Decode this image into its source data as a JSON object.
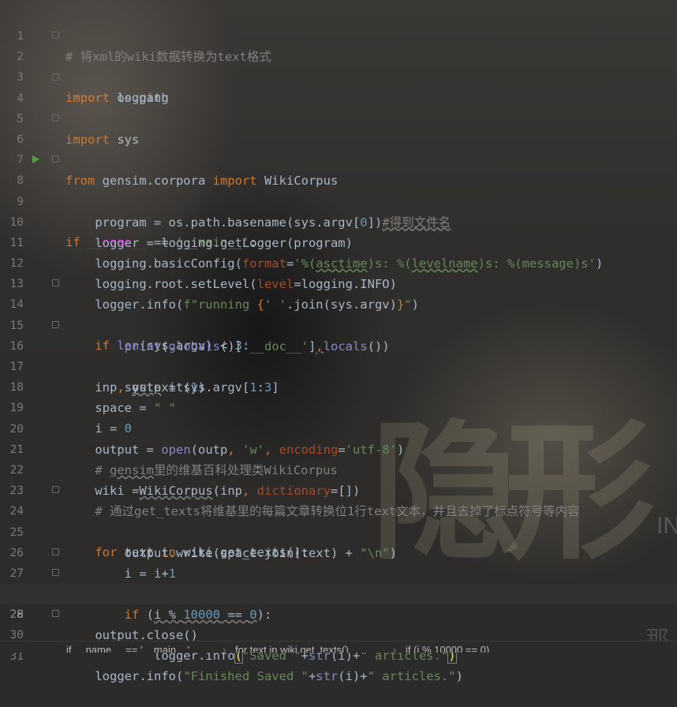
{
  "editor": {
    "active_line": 28,
    "lines": [
      {
        "n": "1"
      },
      {
        "n": "2"
      },
      {
        "n": "3"
      },
      {
        "n": "4"
      },
      {
        "n": "5"
      },
      {
        "n": "6"
      },
      {
        "n": "7"
      },
      {
        "n": "8"
      },
      {
        "n": "9"
      },
      {
        "n": "10"
      },
      {
        "n": "11"
      },
      {
        "n": "12"
      },
      {
        "n": "13"
      },
      {
        "n": "14"
      },
      {
        "n": "15"
      },
      {
        "n": "16"
      },
      {
        "n": "17"
      },
      {
        "n": "18"
      },
      {
        "n": "19"
      },
      {
        "n": "20"
      },
      {
        "n": "21"
      },
      {
        "n": "22"
      },
      {
        "n": "23"
      },
      {
        "n": "24"
      },
      {
        "n": "25"
      },
      {
        "n": "26"
      },
      {
        "n": "27"
      },
      {
        "n": "28"
      },
      {
        "n": "29"
      },
      {
        "n": "30"
      },
      {
        "n": "31"
      }
    ],
    "code": {
      "l1": "# 将xml的wiki数据转换为text格式",
      "l2_kw": "import",
      "l2_rest": " logging",
      "l3_kw": "import",
      "l3_rest": " os.path",
      "l4_kw": "import",
      "l4_rest": " sys",
      "l6_kw1": "from",
      "l6_mid": " gensim.corpora ",
      "l6_kw2": "import",
      "l6_rest": " WikiCorpus",
      "l8_kw": "if",
      "l8_a": " ",
      "l8_dd": "__name__",
      "l8_b": " == ",
      "l8_str": "'__main__'",
      "l8_c": ":",
      "l9_a": "    program = os.path.basename(sys.argv[",
      "l9_num": "0",
      "l9_b": "])",
      "l9_cmt": "#得到文件名",
      "l10": "    logger = logging.getLogger(program)",
      "l11_a": "    logging.basicConfig(",
      "l11_prm": "format",
      "l11_b": "=",
      "l11_s1": "'%(",
      "l11_u1": "asctime",
      "l11_s2": ")s: %(",
      "l11_u2": "levelname",
      "l11_s3": ")s: %(message)s'",
      "l11_c": ")",
      "l12_a": "    logging.root.setLevel(",
      "l12_prm": "level",
      "l12_b": "=logging.INFO)",
      "l13_a": "    logger.info(",
      "l13_s1": "f\"running ",
      "l13_b": "{",
      "l13_s2": "' '",
      "l13_c": ".join(sys.argv)",
      "l13_d": "}",
      "l13_s3": "\"",
      "l13_e": ")",
      "l14_a": "    ",
      "l14_kw": "if",
      "l14_b": " ",
      "l14_bi": "len",
      "l14_c": "(sys.argv) < ",
      "l14_num": "3",
      "l14_d": ":",
      "l15_a": "        ",
      "l15_bi1": "print",
      "l15_b": "(",
      "l15_bi2": "globals",
      "l15_c": "()[",
      "l15_str": "'__doc__'",
      "l15_d": "]",
      "l15_e": ",",
      "l15_bi3": "locals",
      "l15_f": "())",
      "l16_a": "        sys.exit(",
      "l16_num": "1",
      "l16_b": ")",
      "l17_a": "    inp",
      "l17_kw": ",",
      "l17_b": " ",
      "l17_u": "outp",
      "l17_c": " = sys.argv[",
      "l17_n1": "1",
      "l17_d": ":",
      "l17_n2": "3",
      "l17_e": "]",
      "l18_a": "    space = ",
      "l18_str": "\" \"",
      "l19_a": "    i = ",
      "l19_num": "0",
      "l20_a": "    output = ",
      "l20_bi": "open",
      "l20_b": "(outp",
      "l20_k1": ",",
      "l20_s1": " 'w'",
      "l20_k2": ", ",
      "l20_prm": "encoding",
      "l20_c": "=",
      "l20_s2": "'utf-8'",
      "l20_d": ")",
      "l21_a": "    # ",
      "l21_u": "gensim",
      "l21_b": "里的维基百科处理类WikiCorpus",
      "l22_a": "    wiki =",
      "l22_u": "WikiCorpus",
      "l22_b": "(inp",
      "l22_k": ", ",
      "l22_prm": "dictionary",
      "l22_c": "=[])",
      "l23": "    # 通过get_texts将维基里的每篇文章转换位1行text文本，并且去掉了标点符号等内容",
      "l24_a": "    ",
      "l24_kw1": "for",
      "l24_b": " text ",
      "l24_kw2": "in",
      "l24_c": " wiki.get_texts():",
      "l25_a": "        output.write(space.join(text) + ",
      "l25_str": "\"\\n\"",
      "l25_b": ")",
      "l26_a": "        i = i+",
      "l26_num": "1",
      "l27_a": "        ",
      "l27_kw": "if",
      "l27_b": " (",
      "l27_u1": "i % ",
      "l27_num1": "10000",
      "l27_u2": " == ",
      "l27_num2": "0",
      "l27_c": "):",
      "l28_a": "            logger.info",
      "l28_p1": "(",
      "l28_s1": "\"Saved \"",
      "l28_b": "+",
      "l28_bi": "str",
      "l28_c": "(i)+",
      "l28_s2": "\" articles.\"",
      "l28_p2": ")",
      "l29": "    output.close()",
      "l30_a": "    logger.info(",
      "l30_s1": "\"Finished Saved \"",
      "l30_b": "+",
      "l30_bi": "str",
      "l30_c": "(i)+",
      "l30_s2": "\" articles.\"",
      "l30_d": ")"
    }
  },
  "breadcrumb": {
    "items": [
      "if __name__ == '__main__'",
      "for text in wiki.get_texts()",
      "if (i % 10000 == 0)"
    ],
    "separator": "›"
  },
  "background": {
    "title_glyphs": "隐形",
    "small_text": "IN",
    "corner_text": "那"
  },
  "colors": {
    "keyword": "#cc7832",
    "string": "#6a8759",
    "number": "#6897bb",
    "comment": "#808080",
    "builtin": "#8888c6",
    "dunder": "#b200b2",
    "param": "#aa4926",
    "run_icon": "#4faa3c"
  }
}
